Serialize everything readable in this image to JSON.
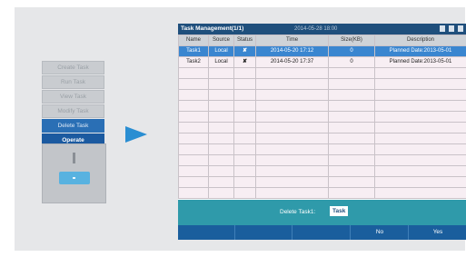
{
  "menu": {
    "items": [
      "Create Task",
      "Run Task",
      "View Task",
      "Modify Task",
      "Delete Task"
    ],
    "operate_label": "Operate"
  },
  "screen": {
    "title": "Task Management(1/1)",
    "datetime": "2014-05-28 18:00",
    "columns": [
      "Name",
      "Source",
      "Status",
      "Time",
      "Size(KB)",
      "Description"
    ],
    "rows": [
      {
        "name": "Task1",
        "source": "Local",
        "status": "✘",
        "time": "2014-05-20 17:12",
        "size": "0",
        "description": "Planned Date:2013-05-01"
      },
      {
        "name": "Task2",
        "source": "Local",
        "status": "✘",
        "time": "2014-05-20 17:37",
        "size": "0",
        "description": "Planned Date:2013-05-01"
      }
    ],
    "message": "Delete Task1:",
    "message_badge": "Task",
    "softkeys": [
      "",
      "",
      "",
      "No",
      "Yes"
    ]
  },
  "colors": {
    "accent": "#2a6fb5",
    "titlebar": "#1f4f7c",
    "statusbar": "#2f9aaa"
  }
}
